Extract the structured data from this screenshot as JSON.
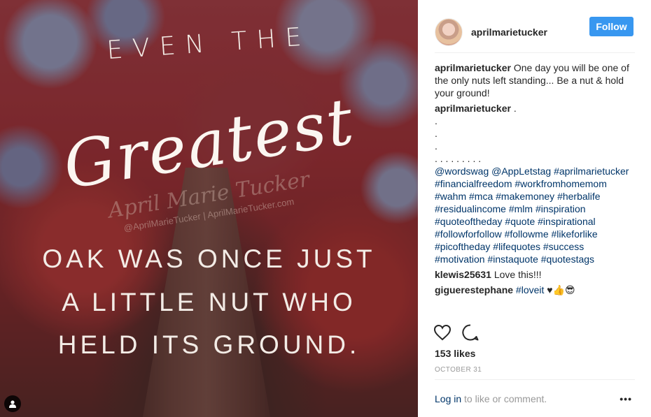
{
  "photo": {
    "line_even_the": "EVEN THE",
    "line_greatest": "Greatest",
    "watermark_name": "April Marie Tucker",
    "watermark_handle": "@AprilMarieTucker | AprilMarieTucker.com",
    "line_1": "OAK WAS ONCE JUST",
    "line_2": "A LITTLE NUT WHO",
    "line_3": "HELD ITS GROUND."
  },
  "header": {
    "username": "aprilmarietucker",
    "follow_label": "Follow"
  },
  "caption": {
    "user": "aprilmarietucker",
    "text": "One day you will be one of the only nuts left standing... Be a nut & hold your ground!"
  },
  "comment_1": {
    "user": "aprilmarietucker",
    "text": " .",
    "dot_1": ".",
    "dot_2": ".",
    "dot_3": ".",
    "dots_line": ". . . . . . . . .",
    "tags": "@wordswag @AppLetstag #aprilmarietucker #financialfreedom #workfromhomemom #wahm #mca #makemoney #herbalife #residualincome #mlm #inspiration #quoteoftheday #quote #inspirational #followforfollow #followme #likeforlike #picoftheday #lifequotes #success #motivation #instaquote #quotestags"
  },
  "comment_2": {
    "user": "klewis25631",
    "text": " Love this!!!"
  },
  "comment_3": {
    "user": "giguerestephane",
    "tag": "#loveit",
    "emoji": " ♥👍😎"
  },
  "likes": "153 likes",
  "date": "OCTOBER 31",
  "footer": {
    "login_label": "Log in",
    "rest": " to like or comment.",
    "more_label": "•••"
  },
  "icons": {
    "like": "heart-icon",
    "comment": "comment-icon",
    "user_tag": "user-tag-icon",
    "more": "more-options-icon"
  }
}
